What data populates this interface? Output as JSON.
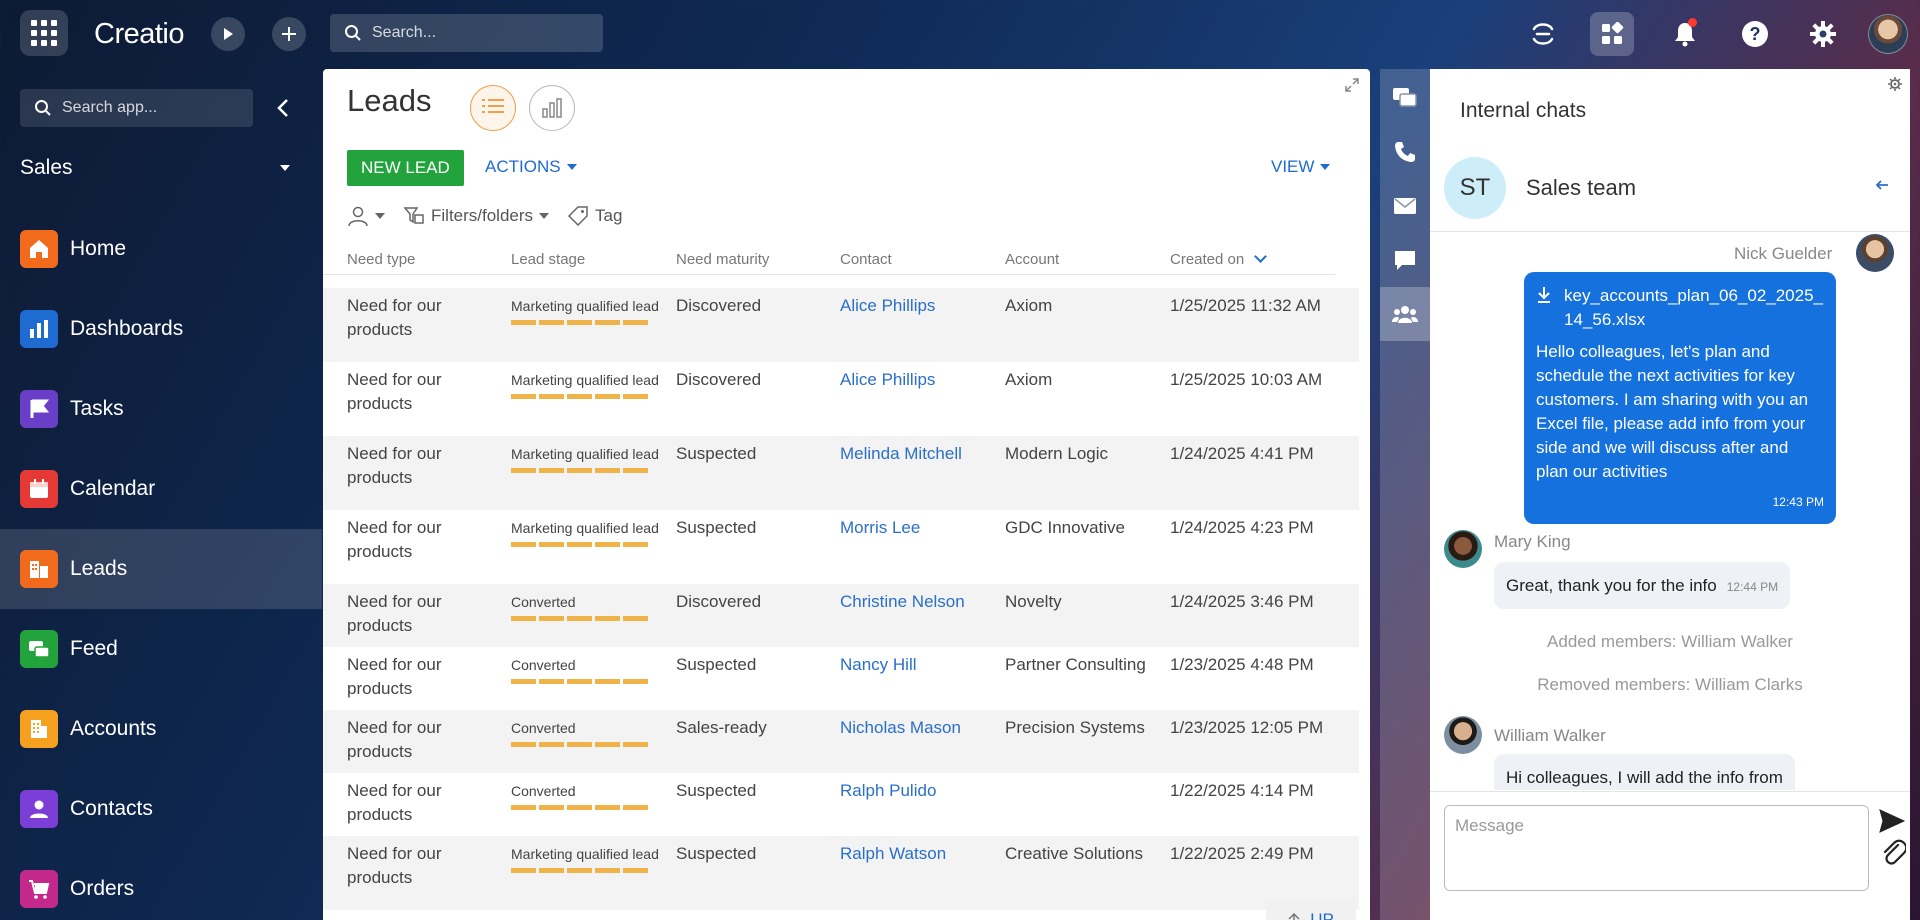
{
  "topbar": {
    "logo": "Creatio",
    "search_placeholder": "Search..."
  },
  "sidebar": {
    "search_placeholder": "Search app...",
    "section": "Sales",
    "items": [
      {
        "label": "Home",
        "icon": "home-icon",
        "color": "#f26b1d"
      },
      {
        "label": "Dashboards",
        "icon": "dashboards-icon",
        "color": "#1e6bd2"
      },
      {
        "label": "Tasks",
        "icon": "tasks-icon",
        "color": "#6a3fc8"
      },
      {
        "label": "Calendar",
        "icon": "calendar-icon",
        "color": "#e53935"
      },
      {
        "label": "Leads",
        "icon": "leads-icon",
        "color": "#f26b1d"
      },
      {
        "label": "Feed",
        "icon": "feed-icon",
        "color": "#22a33b"
      },
      {
        "label": "Accounts",
        "icon": "accounts-icon",
        "color": "#f5a11f"
      },
      {
        "label": "Contacts",
        "icon": "contacts-icon",
        "color": "#7b3fd8"
      },
      {
        "label": "Orders",
        "icon": "orders-icon",
        "color": "#c2298a"
      }
    ]
  },
  "leads": {
    "title": "Leads",
    "new_lead": "NEW LEAD",
    "actions": "ACTIONS",
    "view": "VIEW",
    "filters": "Filters/folders",
    "tag": "Tag",
    "up": "UP",
    "columns": [
      "Need type",
      "Lead stage",
      "Need maturity",
      "Contact",
      "Account",
      "Created on"
    ],
    "rows": [
      {
        "need_type": "Need for our products",
        "stage": "Marketing qualified lead",
        "maturity": "Discovered",
        "contact": "Alice Phillips",
        "account": "Axiom",
        "created": "1/25/2025 11:32 AM"
      },
      {
        "need_type": "Need for our products",
        "stage": "Marketing qualified lead",
        "maturity": "Discovered",
        "contact": "Alice Phillips",
        "account": "Axiom",
        "created": "1/25/2025 10:03 AM"
      },
      {
        "need_type": "Need for our products",
        "stage": "Marketing qualified lead",
        "maturity": "Suspected",
        "contact": "Melinda Mitchell",
        "account": "Modern Logic",
        "created": "1/24/2025 4:41 PM"
      },
      {
        "need_type": "Need for our products",
        "stage": "Marketing qualified lead",
        "maturity": "Suspected",
        "contact": "Morris Lee",
        "account": "GDC Innovative",
        "created": "1/24/2025 4:23 PM"
      },
      {
        "need_type": "Need for our products",
        "stage": "Converted",
        "maturity": "Discovered",
        "contact": "Christine Nelson",
        "account": "Novelty",
        "created": "1/24/2025 3:46 PM"
      },
      {
        "need_type": "Need for our products",
        "stage": "Converted",
        "maturity": "Suspected",
        "contact": "Nancy Hill",
        "account": "Partner Consulting",
        "created": "1/23/2025 4:48 PM"
      },
      {
        "need_type": "Need for our products",
        "stage": "Converted",
        "maturity": "Sales-ready",
        "contact": "Nicholas Mason",
        "account": "Precision Systems",
        "created": "1/23/2025 12:05 PM"
      },
      {
        "need_type": "Need for our products",
        "stage": "Converted",
        "maturity": "Suspected",
        "contact": "Ralph Pulido",
        "account": "",
        "created": "1/22/2025 4:14 PM"
      },
      {
        "need_type": "Need for our products",
        "stage": "Marketing qualified lead",
        "maturity": "Suspected",
        "contact": "Ralph Watson",
        "account": "Creative Solutions",
        "created": "1/22/2025 2:49 PM"
      }
    ]
  },
  "chat": {
    "title": "Internal chats",
    "avatar_initials": "ST",
    "group_name": "Sales team",
    "own_sender": "Nick Guelder",
    "file_name": "key_accounts_plan_06_02_2025_14_56.xlsx",
    "own_text": "Hello colleagues, let's plan and schedule the next activities for key customers. I am sharing with you an Excel file, please add info from your side and we will discuss after and plan our activities",
    "own_time": "12:43 PM",
    "mary_sender": "Mary King",
    "mary_text": "Great, thank you for the info",
    "mary_time": "12:44 PM",
    "sys_added": "Added members: William Walker",
    "sys_removed": "Removed members: William Clarks",
    "william_sender": "William Walker",
    "william_text": "Hi colleagues, I will add the info from",
    "message_placeholder": "Message"
  }
}
